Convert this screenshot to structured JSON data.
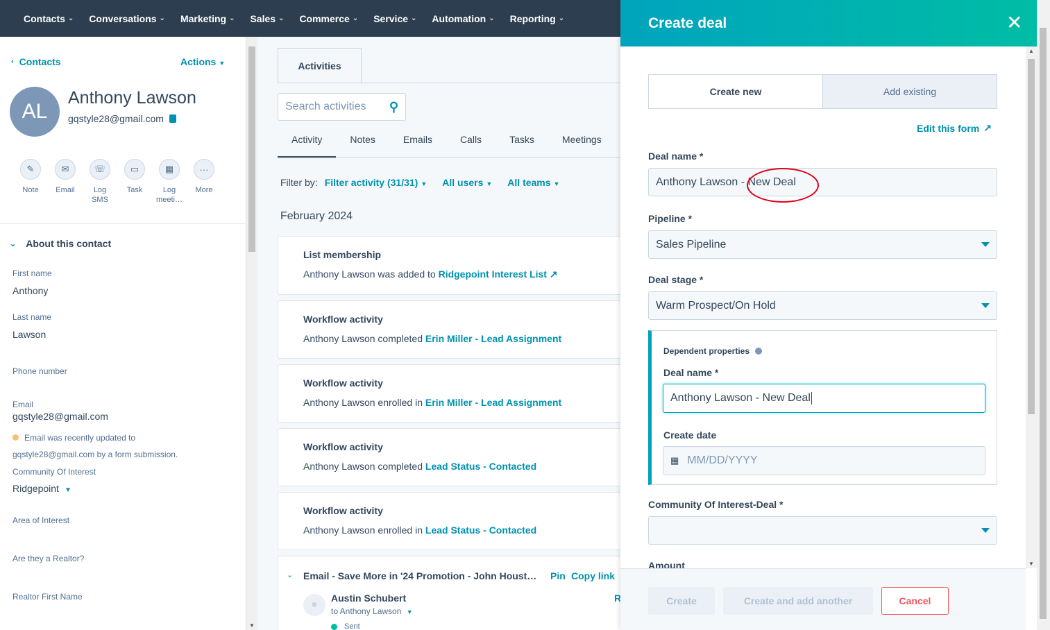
{
  "nav": {
    "items": [
      "Contacts",
      "Conversations",
      "Marketing",
      "Sales",
      "Commerce",
      "Service",
      "Automation",
      "Reporting"
    ]
  },
  "sidebar": {
    "back_label": "Contacts",
    "actions_label": "Actions",
    "avatar_initials": "AL",
    "contact_name": "Anthony Lawson",
    "contact_email": "gqstyle28@gmail.com",
    "quick_actions": [
      {
        "label": "Note",
        "icon": "note-icon"
      },
      {
        "label": "Email",
        "icon": "email-icon"
      },
      {
        "label": "Log SMS",
        "icon": "sms-icon"
      },
      {
        "label": "Task",
        "icon": "task-icon"
      },
      {
        "label": "Log meeti…",
        "icon": "meeting-icon"
      },
      {
        "label": "More",
        "icon": "more-icon"
      }
    ],
    "about_header": "About this contact",
    "props": {
      "first_name_label": "First name",
      "first_name_value": "Anthony",
      "last_name_label": "Last name",
      "last_name_value": "Lawson",
      "phone_label": "Phone number",
      "email_label": "Email",
      "email_value": "gqstyle28@gmail.com",
      "email_note_line1": "Email was recently updated to",
      "email_note_line2": "gqstyle28@gmail.com by a form submission.",
      "community_label": "Community Of Interest",
      "community_value": "Ridgepoint",
      "area_label": "Area of Interest",
      "realtor_label": "Are they a Realtor?",
      "realtor_first_label": "Realtor First Name"
    }
  },
  "middle": {
    "tab_label": "Activities",
    "search_placeholder": "Search activities",
    "activity_tabs": [
      "Activity",
      "Notes",
      "Emails",
      "Calls",
      "Tasks",
      "Meetings"
    ],
    "filter_by": "Filter by:",
    "filter_activity": "Filter activity (31/31)",
    "all_users": "All users",
    "all_teams": "All teams",
    "month": "February 2024",
    "cards": [
      {
        "title": "List membership",
        "text": "Anthony Lawson was added to ",
        "link": "Ridgepoint Interest List"
      },
      {
        "title": "Workflow activity",
        "text": "Anthony Lawson completed ",
        "link": "Erin Miller - Lead Assignment"
      },
      {
        "title": "Workflow activity",
        "text": "Anthony Lawson enrolled in ",
        "link": "Erin Miller - Lead Assignment"
      },
      {
        "title": "Workflow activity",
        "text": "Anthony Lawson completed ",
        "link": "Lead Status - Contacted"
      },
      {
        "title": "Workflow activity",
        "text": "Anthony Lawson enrolled in ",
        "link": "Lead Status - Contacted"
      }
    ],
    "email": {
      "title": "Email - Save More in '24 Promotion - John Houst…",
      "pin": "Pin",
      "copy_link": "Copy link",
      "reply_partial": "R",
      "from": "Austin Schubert",
      "to": "to Anthony Lawson",
      "status": "Sent"
    }
  },
  "panel": {
    "title": "Create deal",
    "seg_create_new": "Create new",
    "seg_add_existing": "Add existing",
    "edit_form": "Edit this form",
    "deal_name_label": "Deal name *",
    "deal_name_value": "Anthony Lawson - New Deal",
    "pipeline_label": "Pipeline *",
    "pipeline_value": "Sales Pipeline",
    "stage_label": "Deal stage *",
    "stage_value": "Warm Prospect/On Hold",
    "dependent_title": "Dependent properties",
    "dep_deal_name_label": "Deal name *",
    "dep_deal_name_value": "Anthony Lawson - New Deal",
    "create_date_label": "Create date",
    "create_date_placeholder": "MM/DD/YYYY",
    "community_label": "Community Of Interest-Deal *",
    "community_value": "",
    "amount_label": "Amount",
    "btn_create": "Create",
    "btn_create_another": "Create and add another",
    "btn_cancel": "Cancel"
  },
  "colors": {
    "nav_bg": "#2d3e50",
    "accent": "#0091ae",
    "header_gradient_start": "#00a4bd",
    "header_gradient_end": "#00bda5",
    "cancel": "#f2545b",
    "annotation": "#e0001a"
  }
}
